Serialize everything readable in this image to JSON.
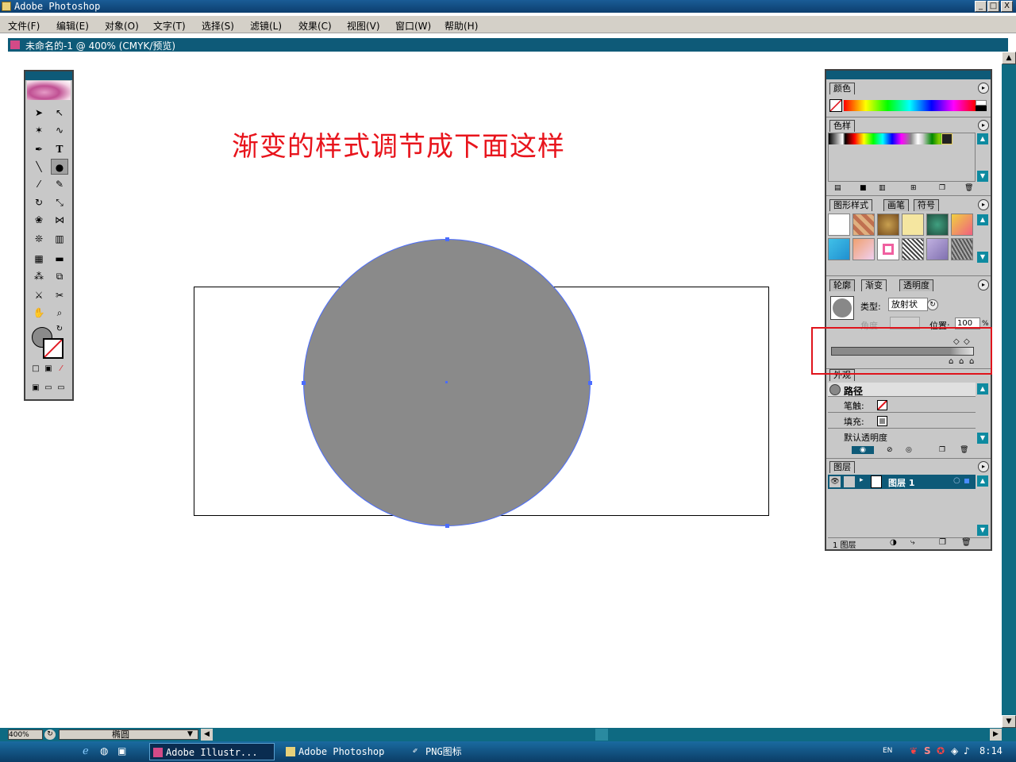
{
  "window": {
    "title": "Adobe Photoshop",
    "min": "_",
    "max": "□",
    "close": "X"
  },
  "menu": [
    "文件(F)",
    "编辑(E)",
    "对象(O)",
    "文字(T)",
    "选择(S)",
    "滤镜(L)",
    "效果(C)",
    "视图(V)",
    "窗口(W)",
    "帮助(H)"
  ],
  "document": {
    "title": "未命名的-1 @ 400% (CMYK/预览)"
  },
  "annotation": "渐变的样式调节成下面这样",
  "panels": {
    "color_tab": "颜色",
    "swatches_tab": "色样",
    "graphic_styles_tabs": [
      "图形样式",
      "画笔",
      "符号"
    ],
    "stroke_tab": "轮廓",
    "gradient_tab": "渐变",
    "transparency_tab": "透明度",
    "gradient": {
      "type_label": "类型:",
      "type_value": "放射状",
      "angle_label": "角度",
      "position_label": "位置:",
      "position_value": "100",
      "percent": "%"
    },
    "appearance_tab": "外观",
    "appearance": {
      "path_label": "路径",
      "stroke_label": "笔触:",
      "fill_label": "填充:",
      "opacity_label": "默认透明度"
    },
    "layers_tab": "图层",
    "layers": {
      "layer_name": "图层 1",
      "footer": "1 图层"
    }
  },
  "status": {
    "zoom": "400%",
    "tool": "椭圆"
  },
  "taskbar": {
    "tasks": [
      "Adobe Illustr...",
      "Adobe Photoshop",
      "PNG图标"
    ],
    "lang": "EN",
    "clock": "8:14"
  },
  "colors": {
    "accent": "#0e5a78",
    "annotation": "#e8141c",
    "selection": "#4a6cff",
    "highlight_box": "#e0141c"
  },
  "icons": [
    "selection-arrow-icon",
    "direct-select-icon",
    "pen-icon",
    "type-icon",
    "ellipse-icon",
    "brush-icon",
    "pencil-icon",
    "rotate-icon",
    "scale-icon",
    "eyedropper-icon",
    "scissors-icon",
    "hand-icon",
    "zoom-icon",
    "eye-icon"
  ]
}
